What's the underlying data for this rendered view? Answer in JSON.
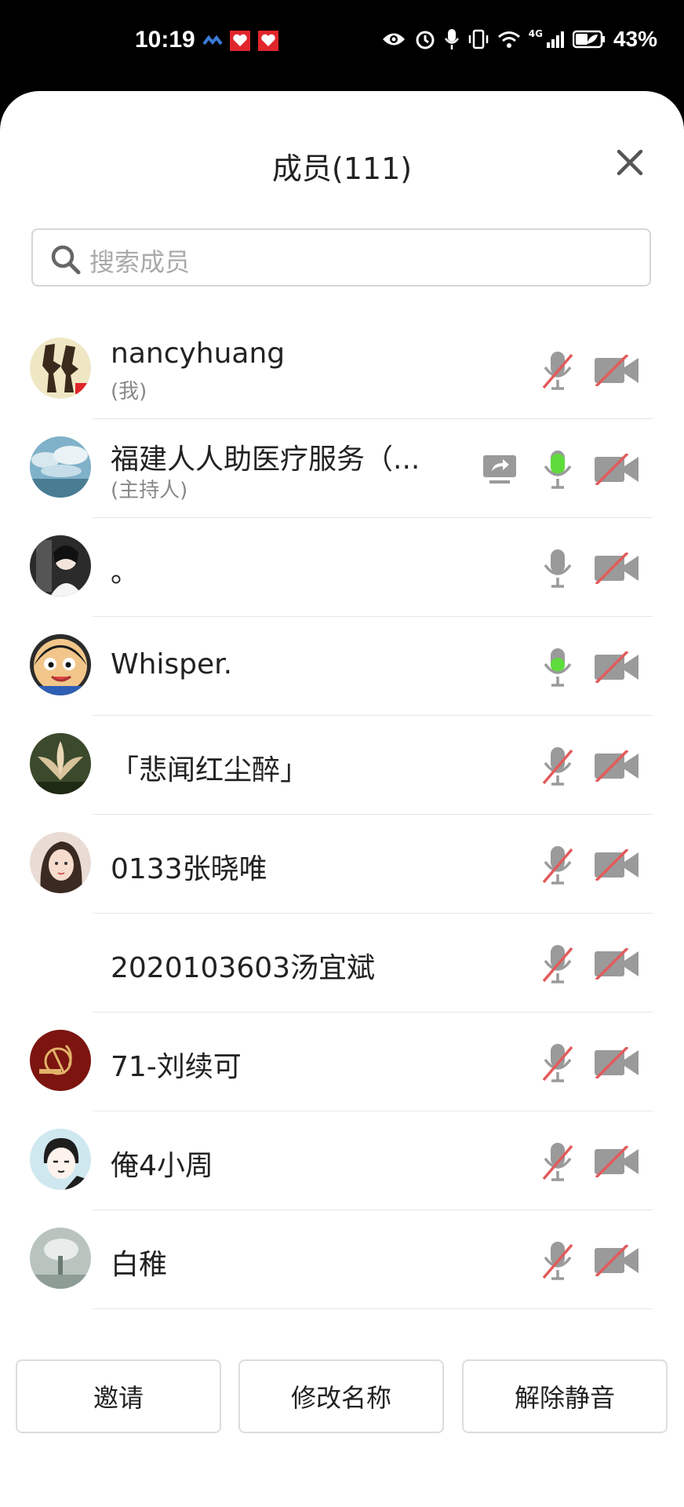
{
  "status_bar": {
    "time": "10:19",
    "network": "4G",
    "battery": "43%"
  },
  "header": {
    "title": "成员(111)"
  },
  "search": {
    "placeholder": "搜索成员"
  },
  "members": [
    {
      "name": "nancyhuang",
      "tag": "(我)",
      "mic": "muted",
      "camera": "off",
      "sharing": false,
      "avatar": "avatar-1"
    },
    {
      "name": "福建人人助医疗服务（...",
      "tag": "(主持人)",
      "mic": "speaking",
      "camera": "off",
      "sharing": true,
      "avatar": "avatar-2"
    },
    {
      "name": "。",
      "tag": "",
      "mic": "on",
      "camera": "off",
      "sharing": false,
      "avatar": "avatar-3"
    },
    {
      "name": "Whisper.",
      "tag": "",
      "mic": "speaking",
      "camera": "off",
      "sharing": false,
      "avatar": "avatar-4"
    },
    {
      "name": "「悲闻红尘醉」",
      "tag": "",
      "mic": "muted",
      "camera": "off",
      "sharing": false,
      "avatar": "avatar-5"
    },
    {
      "name": "0133张晓唯",
      "tag": "",
      "mic": "muted",
      "camera": "off",
      "sharing": false,
      "avatar": "avatar-6"
    },
    {
      "name": "2020103603汤宜斌",
      "tag": "",
      "mic": "muted",
      "camera": "off",
      "sharing": false,
      "avatar": "none"
    },
    {
      "name": "71-刘续可",
      "tag": "",
      "mic": "muted",
      "camera": "off",
      "sharing": false,
      "avatar": "avatar-8"
    },
    {
      "name": "俺4小周",
      "tag": "",
      "mic": "muted",
      "camera": "off",
      "sharing": false,
      "avatar": "avatar-9"
    },
    {
      "name": "白稚",
      "tag": "",
      "mic": "muted",
      "camera": "off",
      "sharing": false,
      "avatar": "avatar-10"
    }
  ],
  "buttons": {
    "invite": "邀请",
    "rename": "修改名称",
    "unmute": "解除静音"
  },
  "colors": {
    "mic_speaking": "#5edc3c",
    "muted_slash": "#e25b5b",
    "icon_gray": "#9a9a9a"
  }
}
